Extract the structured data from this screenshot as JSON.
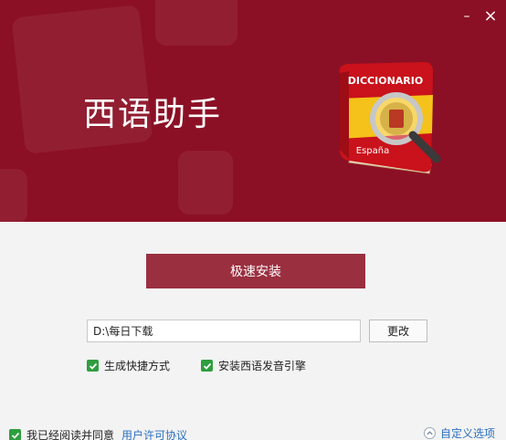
{
  "window": {
    "minimize_glyph": "–",
    "close_glyph": "×"
  },
  "banner": {
    "app_title": "西语助手",
    "book_label_top": "DICCIONARIO",
    "book_label_bottom": "España",
    "background_color": "#8c1025"
  },
  "main": {
    "install_label": "极速安装",
    "path_value": "D:\\每日下载",
    "change_label": "更改"
  },
  "options": {
    "shortcut_label": "生成快捷方式",
    "engine_label": "安装西语发音引擎"
  },
  "footer": {
    "agree_label": "我已经阅读并同意",
    "license_link": "用户许可协议",
    "custom_label": "自定义选项"
  },
  "colors": {
    "accent": "#9a2f40",
    "check": "#2e9e3e",
    "link": "#2a6fc0"
  }
}
